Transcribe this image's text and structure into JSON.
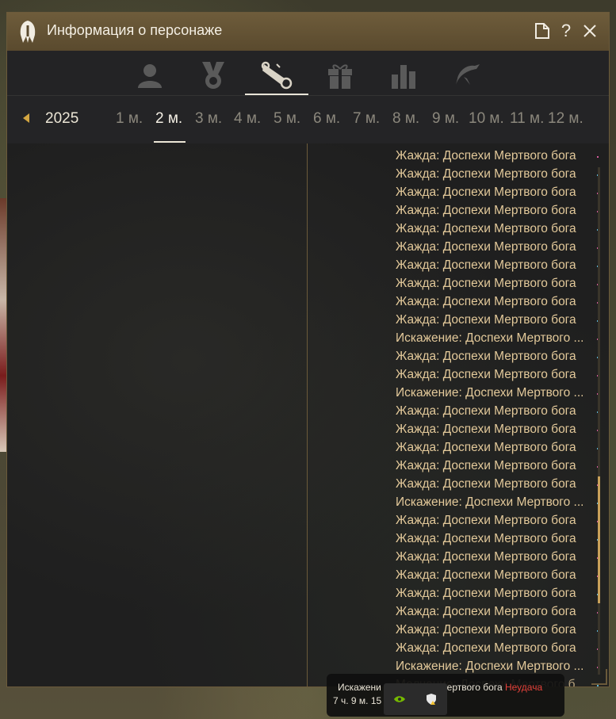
{
  "window": {
    "title": "Информация о персонаже"
  },
  "tabs": [
    {
      "name": "profile-tab",
      "icon": "person-icon",
      "active": false
    },
    {
      "name": "achievements-tab",
      "icon": "medal-icon",
      "active": false
    },
    {
      "name": "history-tab",
      "icon": "scroll-icon",
      "active": true
    },
    {
      "name": "rewards-tab",
      "icon": "gift-icon",
      "active": false
    },
    {
      "name": "stats-tab",
      "icon": "bar-chart-icon",
      "active": false
    },
    {
      "name": "pets-tab",
      "icon": "creature-icon",
      "active": false
    }
  ],
  "calendar": {
    "year": "2025",
    "months": [
      "1 м.",
      "2 м.",
      "3 м.",
      "4 м.",
      "5 м.",
      "6 м.",
      "7 м.",
      "8 м.",
      "9 м.",
      "10 м.",
      "11 м.",
      "12 м."
    ],
    "selected_month": "2 м."
  },
  "log_entries": [
    "Жажда: Доспехи Мертвого бога",
    "Жажда: Доспехи Мертвого бога",
    "Жажда: Доспехи Мертвого бога",
    "Жажда: Доспехи Мертвого бога",
    "Жажда: Доспехи Мертвого бога",
    "Жажда: Доспехи Мертвого бога",
    "Жажда: Доспехи Мертвого бога",
    "Жажда: Доспехи Мертвого бога",
    "Жажда: Доспехи Мертвого бога",
    "Жажда: Доспехи Мертвого бога",
    "Искажение: Доспехи Мертвого ...",
    "Жажда: Доспехи Мертвого бога",
    "Жажда: Доспехи Мертвого бога",
    "Искажение: Доспехи Мертвого ...",
    "Жажда: Доспехи Мертвого бога",
    "Жажда: Доспехи Мертвого бога",
    "Жажда: Доспехи Мертвого бога",
    "Жажда: Доспехи Мертвого бога",
    "Жажда: Доспехи Мертвого бога",
    "Искажение: Доспехи Мертвого ...",
    "Жажда: Доспехи Мертвого бога",
    "Жажда: Доспехи Мертвого бога",
    "Жажда: Доспехи Мертвого бога",
    "Жажда: Доспехи Мертвого бога",
    "Жажда: Доспехи Мертвого бога",
    "Жажда: Доспехи Мертвого бога",
    "Жажда: Доспехи Мертвого бога",
    "Жажда: Доспехи Мертвого бога",
    "Искажение: Доспехи Мертвого ...",
    "Молчание: Доспехи Мертвого б..."
  ],
  "notification": {
    "line1_prefix": "Искажени",
    "line1_suffix": "Мертвого бога",
    "status": "Неудача",
    "line2": "7 ч. 9 м. 15"
  },
  "colors": {
    "accent": "#c9a15a",
    "title_bar": "#6e5c3b",
    "log_text": "#e3c99a",
    "fail": "#e3413a"
  }
}
